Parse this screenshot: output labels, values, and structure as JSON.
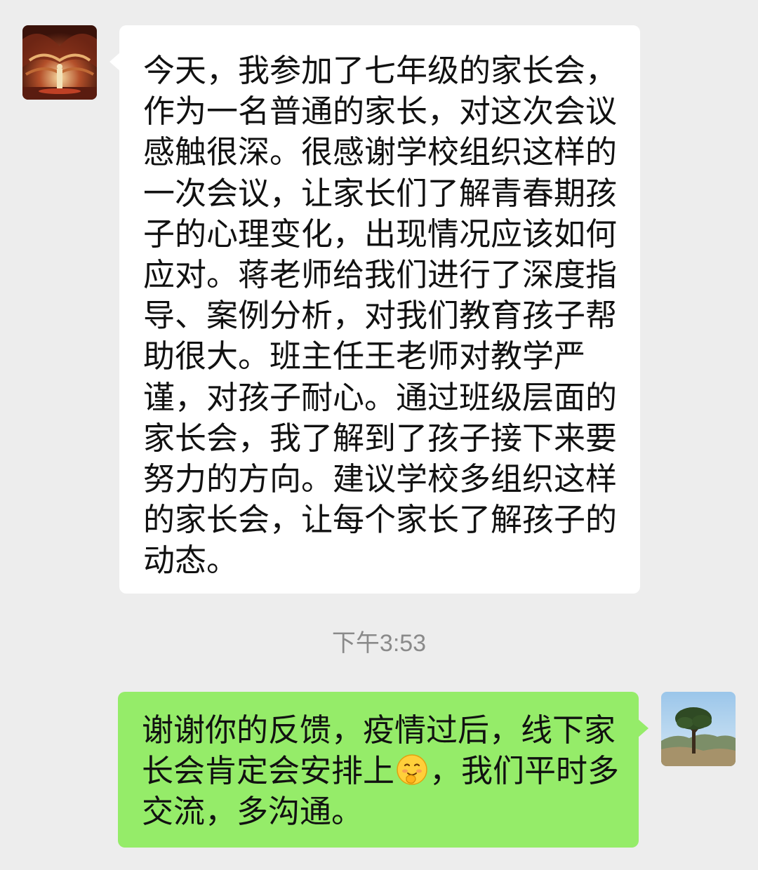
{
  "messages": [
    {
      "direction": "incoming",
      "avatar": "theatre-stage-avatar",
      "lines": [
        "今天，我参加了七年级的家长会，",
        "作为一名普通的家长，对这次会议",
        "感触很深。很感谢学校组织这样的",
        "一次会议，让家长们了解青春期孩",
        "子的心理变化，出现情况应该如何",
        "应对。蒋老师给我们进行了深度指",
        "导、案例分析，对我们教育孩子帮",
        "助很大。班主任王老师对教学严",
        "谨，对孩子耐心。通过班级层面的",
        "家长会，我了解到了孩子接下来要",
        "努力的方向。建议学校多组织这样",
        "的家长会，让每个家长了解孩子的",
        "动态。"
      ]
    },
    {
      "direction": "outgoing",
      "avatar": "tree-landscape-avatar",
      "line1": "谢谢你的反馈，疫情过后，线下家",
      "line2_before_emoji": "长会肯定会安排上",
      "emoji": "shy-smile-emoji",
      "line2_after_emoji": "，我们平时多",
      "line3": "交流，多沟通。"
    }
  ],
  "timestamp": "下午3:53",
  "colors": {
    "background": "#ededed",
    "incoming_bubble": "#ffffff",
    "outgoing_bubble": "#95ec69",
    "timestamp_text": "#8a8a8a"
  }
}
